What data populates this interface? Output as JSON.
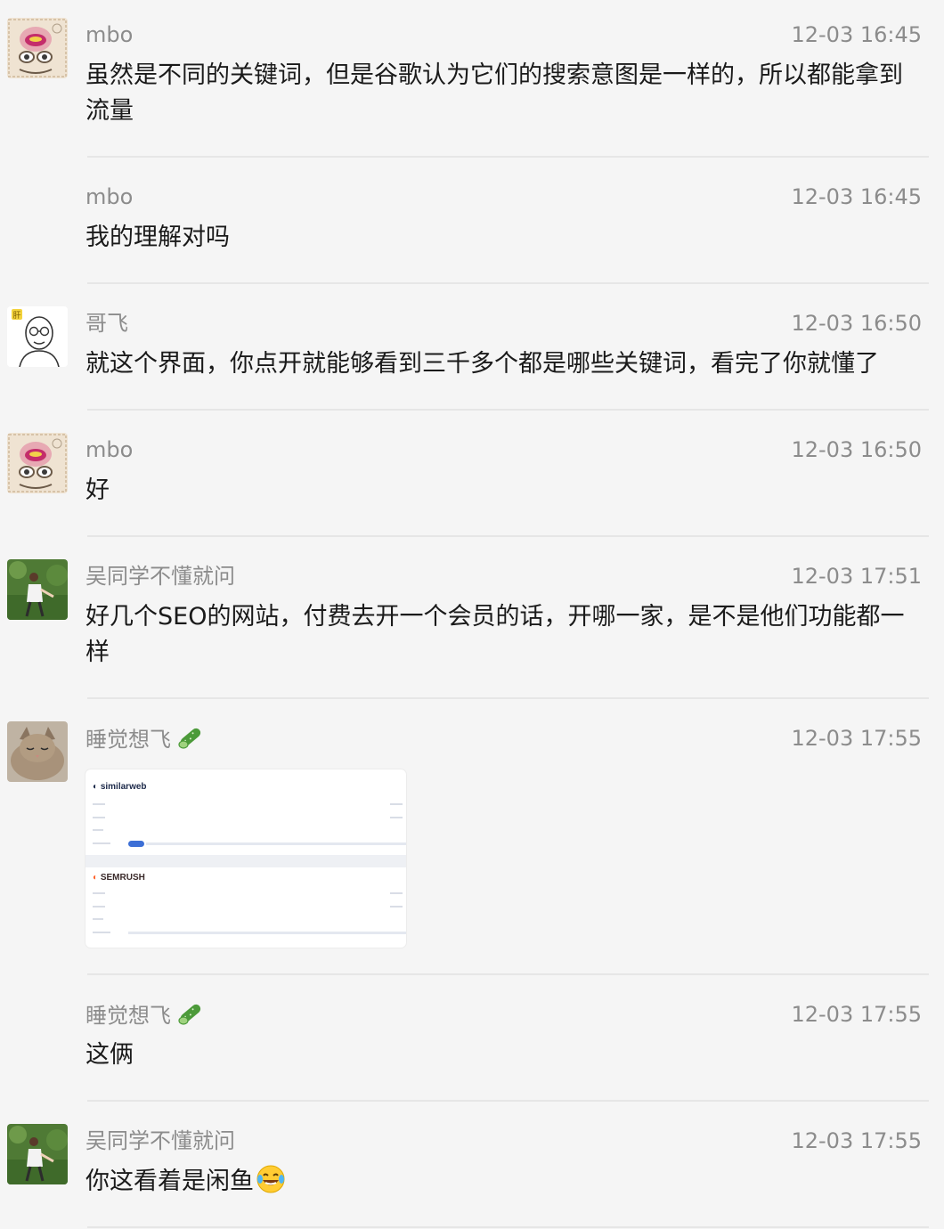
{
  "messages": [
    {
      "name": "mbo",
      "time": "12-03 16:45",
      "text": "虽然是不同的关键词，但是谷歌认为它们的搜索意图是一样的，所以都能拿到流量"
    },
    {
      "name": "mbo",
      "time": "12-03 16:45",
      "text": "我的理解对吗"
    },
    {
      "name": "哥飞",
      "time": "12-03 16:50",
      "text": "就这个界面，你点开就能够看到三千多个都是哪些关键词，看完了你就懂了"
    },
    {
      "name": "mbo",
      "time": "12-03 16:50",
      "text": "好"
    },
    {
      "name": "吴同学不懂就问",
      "time": "12-03 17:51",
      "text": "好几个SEO的网站，付费去开一个会员的话，开哪一家，是不是他们功能都一样"
    },
    {
      "name": "睡觉想飞",
      "time": "12-03 17:55",
      "image": {
        "brand_top": "similarweb",
        "brand_bottom": "SEMRUSH"
      }
    },
    {
      "name": "睡觉想飞",
      "time": "12-03 17:55",
      "text": "这俩"
    },
    {
      "name": "吴同学不懂就问",
      "time": "12-03 17:55",
      "text": "你这看着是闲鱼"
    }
  ],
  "icons": {
    "name_badge": "cucumber-icon",
    "emoji": "laughing-tears-emoji"
  },
  "colors": {
    "background": "#f5f5f5",
    "meta_text": "#8c8c8c",
    "body_text": "#1a1a1a",
    "divider": "#e6e6e6"
  }
}
